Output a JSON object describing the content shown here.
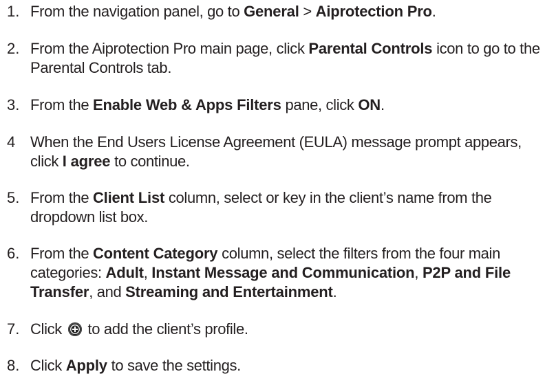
{
  "steps": [
    {
      "number": "1.",
      "t1": "From the navigation panel, go to ",
      "b1": "General",
      "t2": " > ",
      "b2": "Aiprotection Pro",
      "t3": "."
    },
    {
      "number": "2.",
      "t1": "From the Aiprotection Pro main page, click ",
      "b1": "Parental Controls",
      "t2": " icon to go to the Parental Controls tab."
    },
    {
      "number": "3.",
      "t1": "From the ",
      "b1": "Enable Web & Apps Filters",
      "t2": " pane, click ",
      "b2": "ON",
      "t3": "."
    },
    {
      "number": "4",
      "t1": "When the End Users License Agreement (EULA) message prompt appears, click ",
      "b1": "I agree",
      "t2": " to continue."
    },
    {
      "number": "5.",
      "t1": "From the ",
      "b1": "Client List",
      "t2": " column, select or key in the client’s name from the dropdown list box."
    },
    {
      "number": "6.",
      "t1": "From the ",
      "b1": "Content Category",
      "t2": " column, select the filters from the four main categories: ",
      "b2": "Adult",
      "t3": ", ",
      "b3": "Instant Message and Communication",
      "t4": ", ",
      "b4": "P2P and File Transfer",
      "t5": ", and ",
      "b5": "Streaming and Entertainment",
      "t6": "."
    },
    {
      "number": "7.",
      "t1": "Click ",
      "icon": "circled-plus-icon",
      "t2": " to add the client’s profile."
    },
    {
      "number": "8.",
      "t1": "Click ",
      "b1": "Apply",
      "t2": " to save the settings."
    }
  ]
}
